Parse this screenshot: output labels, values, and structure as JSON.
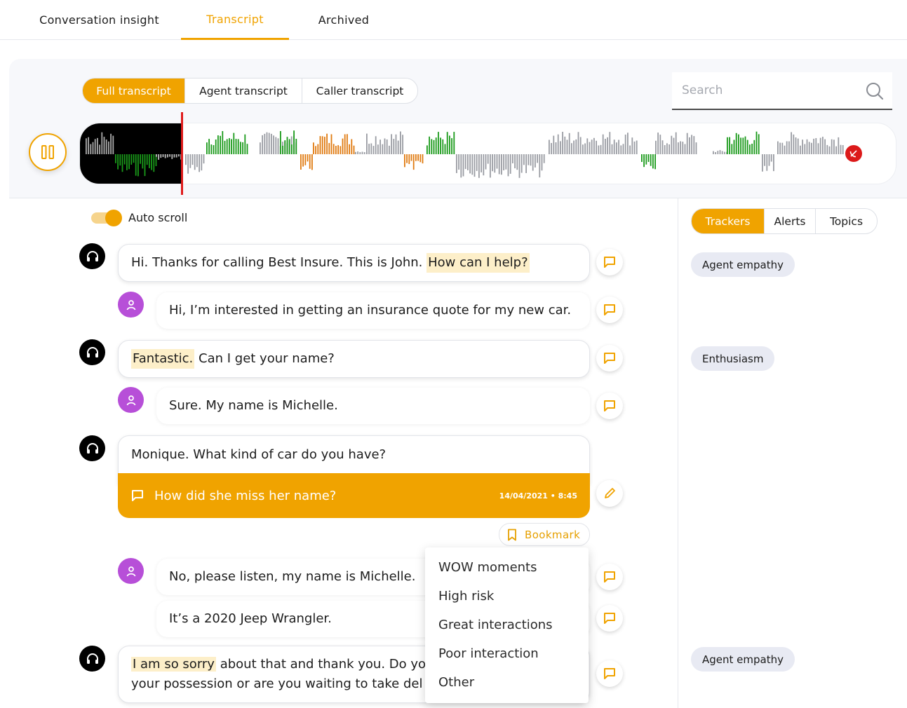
{
  "top_tabs": [
    "Conversation insight",
    "Transcript",
    "Archived"
  ],
  "active_top_tab": "Transcript",
  "transcript_filter": {
    "options": [
      "Full transcript",
      "Agent transcript",
      "Caller transcript"
    ],
    "active": "Full transcript"
  },
  "search": {
    "placeholder": "Search",
    "value": ""
  },
  "player": {
    "state": "playing"
  },
  "autoscroll": {
    "label": "Auto scroll",
    "on": true
  },
  "right_tabs": {
    "options": [
      "Trackers",
      "Alerts",
      "Topics"
    ],
    "active": "Trackers"
  },
  "trackers": [
    "Agent empathy",
    "Enthusiasm",
    "Agent empathy"
  ],
  "messages": [
    {
      "speaker": "agent",
      "before": "Hi. Thanks for calling Best Insure. This is John. ",
      "highlight": "How can I help?",
      "after": ""
    },
    {
      "speaker": "caller",
      "text": "Hi, I’m interested in getting an insurance quote for my new car."
    },
    {
      "speaker": "agent",
      "before": "",
      "highlight": "Fantastic.",
      "after": " Can I get your name?"
    },
    {
      "speaker": "caller",
      "text": "Sure. My name is Michelle."
    },
    {
      "speaker": "agent",
      "text": "Monique. What kind of car do you have?"
    },
    {
      "speaker": "caller",
      "text": "No, please listen, my name is Michelle."
    },
    {
      "speaker": "caller",
      "text": "It’s a 2020 Jeep Wrangler."
    },
    {
      "speaker": "agent",
      "highlight": "I am so sorry",
      "line1_rest": " about that and thank you. Do you",
      "line2": "your possession or are you waiting to take del"
    }
  ],
  "comment": {
    "text": "How did she miss her name?",
    "date": "14/04/2021 • 8:45"
  },
  "bookmark": {
    "label": "Bookmark"
  },
  "bookmark_menu": [
    "WOW moments",
    "High risk",
    "Great interactions",
    "Poor interaction",
    "Other"
  ],
  "colors": {
    "accent": "#f0a300",
    "caller": "#b74fd8",
    "agent": "#000000",
    "positive": "#1a9a1a",
    "negative": "#e07a10",
    "neutral": "#9a9ca3",
    "end": "#dc1a1a"
  }
}
